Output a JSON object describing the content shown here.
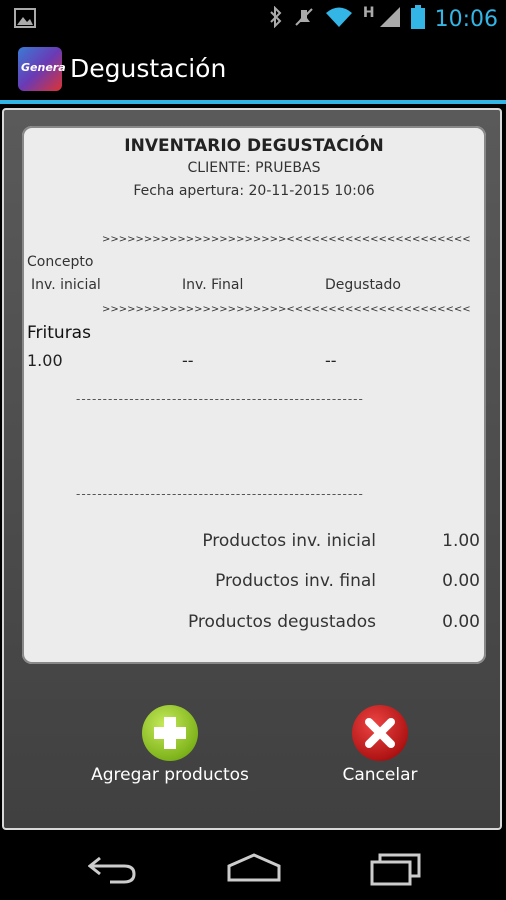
{
  "status_bar": {
    "time": "10:06",
    "network_type": "H",
    "icons": [
      "image-icon",
      "bluetooth-icon",
      "mute-icon",
      "wifi-icon",
      "signal-icon",
      "battery-icon"
    ]
  },
  "action_bar": {
    "app_icon_text": "Genera",
    "title": "Degustación"
  },
  "receipt": {
    "title": "INVENTARIO DEGUSTACIÓN",
    "client": "CLIENTE: PRUEBAS",
    "date": "Fecha apertura: 20-11-2015 10:06",
    "separator": ">>>>>>>>>>>>>>>>>>>>>><<<<<<<<<<<<<<<<<<<<<<",
    "headers": {
      "concept": "Concepto",
      "inv_initial": "Inv. inicial",
      "inv_final": "Inv. Final",
      "tasted": "Degustado"
    },
    "items": [
      {
        "name": "Frituras",
        "inv_initial": "1.00",
        "inv_final": "--",
        "tasted": "--"
      }
    ],
    "dashed_line": "------------------------------------------------------",
    "summary": [
      {
        "label": "Productos inv. inicial",
        "value": "1.00"
      },
      {
        "label": "Productos inv. final",
        "value": "0.00"
      },
      {
        "label": "Productos degustados",
        "value": "0.00"
      }
    ]
  },
  "buttons": {
    "add_label": "Agregar productos",
    "cancel_label": "Cancelar"
  },
  "colors": {
    "accent": "#33b5e5",
    "add_green": "#8cc63f",
    "cancel_red": "#c0141c"
  }
}
